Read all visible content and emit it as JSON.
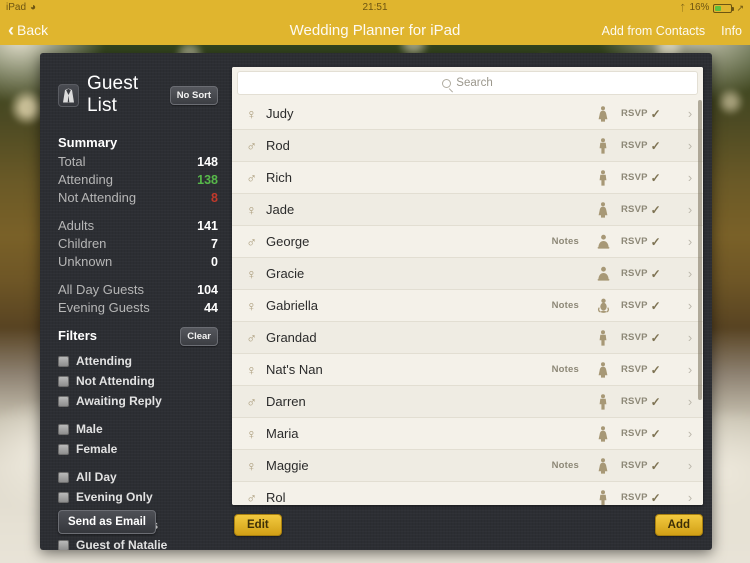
{
  "status_bar": {
    "device": "iPad",
    "wifi_icon": "wifi-icon",
    "time": "21:51",
    "bluetooth_icon": "bluetooth-icon",
    "battery_percent": "16%"
  },
  "nav_bar": {
    "back_label": "Back",
    "back_icon": "chevron-left-icon",
    "title": "Wedding Planner for iPad",
    "add_from_contacts_label": "Add from Contacts",
    "info_label": "Info"
  },
  "sidebar": {
    "icon": "tuxedo-icon",
    "title": "Guest List",
    "sort_button_label": "No Sort",
    "summary_heading": "Summary",
    "summary": [
      {
        "label": "Total",
        "value": "148",
        "color": "#ffffff"
      },
      {
        "label": "Attending",
        "value": "138",
        "color": "#57b84a"
      },
      {
        "label": "Not Attending",
        "value": "8",
        "color": "#c0392b"
      },
      {
        "label": "Adults",
        "value": "141",
        "color": "#ffffff"
      },
      {
        "label": "Children",
        "value": "7",
        "color": "#ffffff"
      },
      {
        "label": "Unknown",
        "value": "0",
        "color": "#ffffff"
      },
      {
        "label": "All Day Guests",
        "value": "104",
        "color": "#ffffff"
      },
      {
        "label": "Evening Guests",
        "value": "44",
        "color": "#ffffff"
      }
    ],
    "filters_heading": "Filters",
    "clear_button_label": "Clear",
    "filters": [
      {
        "label": "Attending",
        "checked": false
      },
      {
        "label": "Not Attending",
        "checked": false
      },
      {
        "label": "Awaiting Reply",
        "checked": false
      },
      {
        "label": "Male",
        "checked": false
      },
      {
        "label": "Female",
        "checked": false
      },
      {
        "label": "All Day",
        "checked": false
      },
      {
        "label": "Evening Only",
        "checked": false
      },
      {
        "label": "Guest of Kriss",
        "checked": false
      },
      {
        "label": "Guest of Natalie",
        "checked": false
      }
    ],
    "send_email_button_label": "Send as Email"
  },
  "guest_list": {
    "search_placeholder": "Search",
    "search_icon": "search-icon",
    "rsvp_label": "RSVP",
    "notes_label": "Notes",
    "rows": [
      {
        "name": "Judy",
        "gender": "female",
        "person_type": "adult-female",
        "notes": false
      },
      {
        "name": "Rod",
        "gender": "male",
        "person_type": "adult-male",
        "notes": false
      },
      {
        "name": "Rich",
        "gender": "male",
        "person_type": "adult-male",
        "notes": false
      },
      {
        "name": "Jade",
        "gender": "female",
        "person_type": "adult-female",
        "notes": false
      },
      {
        "name": "George",
        "gender": "male",
        "person_type": "child",
        "notes": true
      },
      {
        "name": "Gracie",
        "gender": "female",
        "person_type": "child",
        "notes": false
      },
      {
        "name": "Gabriella",
        "gender": "female",
        "person_type": "baby",
        "notes": true
      },
      {
        "name": "Grandad",
        "gender": "male",
        "person_type": "adult-male",
        "notes": false
      },
      {
        "name": "Nat's Nan",
        "gender": "female",
        "person_type": "adult-female",
        "notes": true
      },
      {
        "name": "Darren",
        "gender": "male",
        "person_type": "adult-male",
        "notes": false
      },
      {
        "name": "Maria",
        "gender": "female",
        "person_type": "adult-female",
        "notes": false
      },
      {
        "name": "Maggie",
        "gender": "female",
        "person_type": "adult-female",
        "notes": true
      },
      {
        "name": "Rol",
        "gender": "male",
        "person_type": "adult-male",
        "notes": false
      }
    ]
  },
  "toolbar": {
    "edit_label": "Edit",
    "add_label": "Add"
  },
  "colors": {
    "nav_gold": "#e0b52e",
    "panel_dark": "#2c2e33",
    "list_cream": "#f4f1e9",
    "accent_gold_button": "#e8bc2c",
    "attending_green": "#57b84a",
    "not_attending_red": "#c0392b"
  }
}
